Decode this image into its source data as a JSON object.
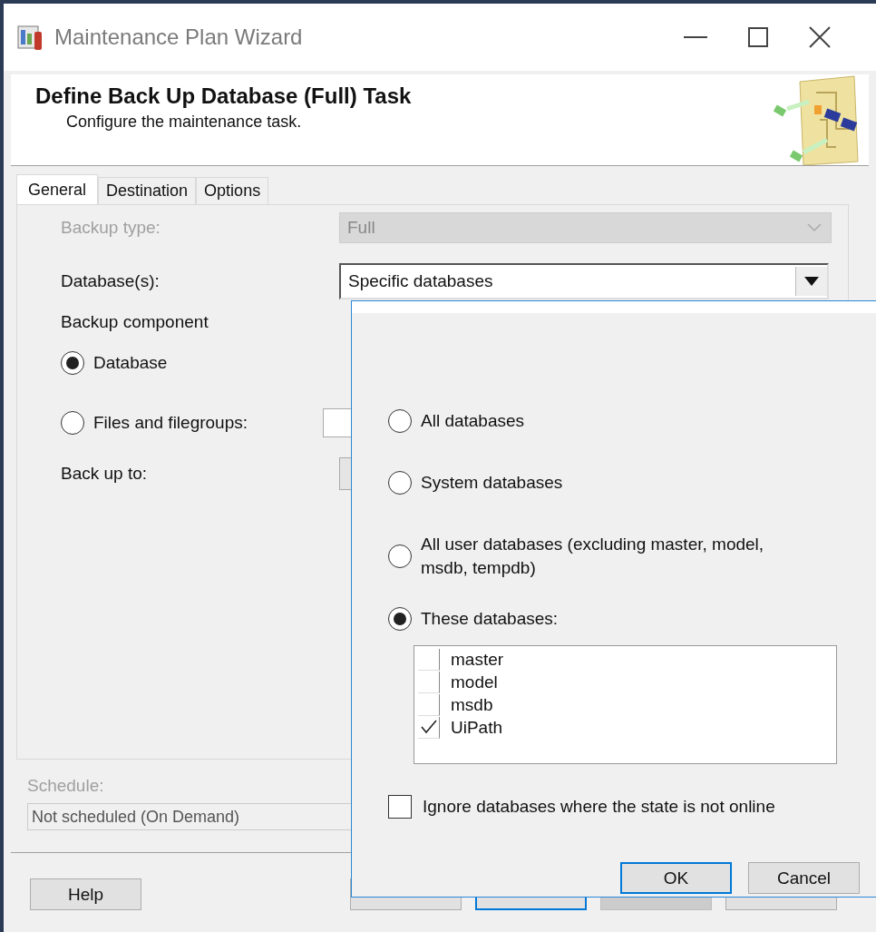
{
  "window": {
    "title": "Maintenance Plan Wizard"
  },
  "header": {
    "title": "Define Back Up Database (Full) Task",
    "subtitle": "Configure the maintenance task."
  },
  "tabs": [
    {
      "label": "General",
      "selected": true
    },
    {
      "label": "Destination",
      "selected": false
    },
    {
      "label": "Options",
      "selected": false
    }
  ],
  "general": {
    "backup_type": {
      "label": "Backup type:",
      "value": "Full",
      "disabled": true
    },
    "databases": {
      "label": "Database(s):",
      "value": "Specific databases"
    },
    "backup_component": {
      "label": "Backup component",
      "options": [
        {
          "label": "Database",
          "selected": true
        },
        {
          "label": "Files and filegroups:",
          "selected": false
        }
      ]
    },
    "back_up_to": {
      "label": "Back up to:"
    }
  },
  "schedule": {
    "label": "Schedule:",
    "value": "Not scheduled (On Demand)",
    "disabled": true
  },
  "buttons": [
    {
      "label": "Help",
      "default": false,
      "disabled": false
    },
    {
      "default": false,
      "disabled": false
    },
    {
      "default": true,
      "disabled": false
    },
    {
      "default": false,
      "disabled": true
    },
    {
      "default": false,
      "disabled": false
    }
  ],
  "database_popup": {
    "options": [
      {
        "label": "All databases",
        "selected": false
      },
      {
        "label": "System databases",
        "selected": false
      },
      {
        "label": "All user databases  (excluding master, model, msdb, tempdb)",
        "selected": false
      },
      {
        "label": "These databases:",
        "selected": true
      }
    ],
    "databases": [
      {
        "name": "master",
        "checked": false
      },
      {
        "name": "model",
        "checked": false
      },
      {
        "name": "msdb",
        "checked": false
      },
      {
        "name": "UiPath",
        "checked": true
      }
    ],
    "ignore_offline": {
      "label": "Ignore databases where the state is not online",
      "checked": false
    },
    "buttons": [
      {
        "label": "OK",
        "default": true
      },
      {
        "label": "Cancel",
        "default": false
      }
    ]
  }
}
